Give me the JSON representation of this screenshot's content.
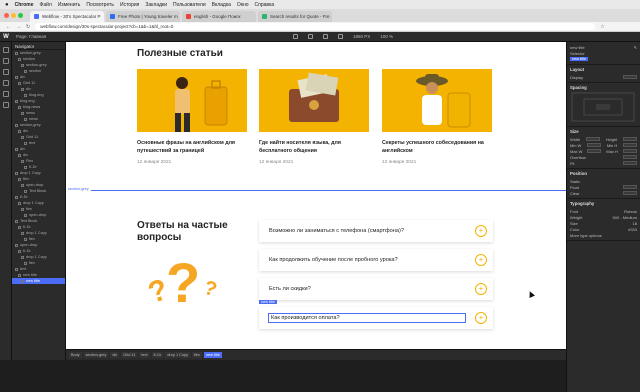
{
  "menubar": {
    "app": "Chrome",
    "items": [
      "Файл",
      "Изменить",
      "Посмотреть",
      "История",
      "Закладки",
      "Пользователи",
      "Вкладка",
      "Окно",
      "Справка"
    ]
  },
  "tabs": [
    {
      "label": "Webflow - 30's Spectacular P"
    },
    {
      "label": "Free Photo | Young traveler m"
    },
    {
      "label": "english - Google Поиск"
    },
    {
      "label": "Search results for Quote - Fre"
    }
  ],
  "address": {
    "url": "webflow.com/design/30s-spectacular-project?cb=1&b=1&hl_root=0"
  },
  "editor": {
    "page_label": "Page: Главная",
    "zoom": "1860 PX",
    "width_label": "100 %"
  },
  "navigator": {
    "title": "Navigator",
    "items": [
      "section-grey",
      "section",
      "section-grey",
      "section",
      "div",
      "Grid 11",
      "div",
      "blog-img",
      "blog-img",
      "blog-news",
      "news",
      "news",
      "section-grey",
      "div",
      "Grid 11",
      "text",
      "div",
      "div",
      "Flex",
      "K-Dr",
      "drop 1 Copy",
      "flex",
      "open-drop",
      "Text Block",
      "K-Dr",
      "drop 1 Copy",
      "flex",
      "open-drop",
      "Text Block",
      "K-Dr",
      "drop 1 Copy",
      "flex",
      "open-drop",
      "K-Dr",
      "drop 1 Copy",
      "flex",
      "text",
      "new title",
      "new title"
    ]
  },
  "section1": {
    "heading": "Полезные статьи",
    "cards": [
      {
        "title": "Основные фразы на английском для путешествий за границей",
        "date": "12 января 2021"
      },
      {
        "title": "Где найти носителя языка, для бесплатного общения",
        "date": "12 января 2021"
      },
      {
        "title": "Секреты успешного собеседования на английском",
        "date": "12 января 2021"
      }
    ]
  },
  "section_tag": "section-grey",
  "faq": {
    "heading": "Ответы на частые вопросы",
    "items": [
      {
        "q": "Возможно ли заниматься с телефона (смартфона)?"
      },
      {
        "q": "Как продолжить обучение после пробного урока?"
      },
      {
        "q": "Есть ли скидки?"
      },
      {
        "q": "Как производится оплата?"
      }
    ],
    "selected_tag": "new title"
  },
  "panel": {
    "element": "new title",
    "selector_label": "Selector",
    "selector_value": "new title",
    "layout": "Layout",
    "display": "Display",
    "spacing": "Spacing",
    "size": "Size",
    "size_rows": [
      "Width",
      "Height",
      "Min W",
      "Min H",
      "Max W",
      "Max H"
    ],
    "overflow": "Overflow",
    "fit": "Fit",
    "position": "Position",
    "position_value": "Static",
    "float": "Float",
    "clear": "Clear",
    "typography": "Typography",
    "font_label": "Font",
    "font_value": "Roboto",
    "weight_label": "Weight",
    "weight_value": "500 - Medium",
    "size_label": "Size",
    "size_value": "18",
    "color_label": "Color",
    "color_value": "#333",
    "more": "More type options"
  },
  "breadcrumbs": [
    "Body",
    "section-grey",
    "div",
    "Grid 11",
    "text",
    "K-Dr",
    "drop 1 Copy",
    "flex",
    "new title"
  ],
  "colors": {
    "accent": "#4a6cf7",
    "brand_yellow": "#f5b301"
  }
}
